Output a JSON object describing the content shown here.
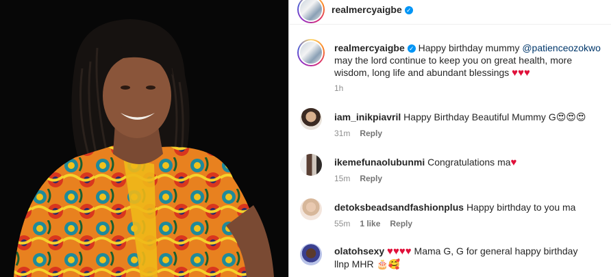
{
  "post": {
    "author": "realmercyaigbe",
    "caption_text": "Happy birthday mummy",
    "caption_mention": "@patienceozokwo",
    "caption_rest": "may the lord continue to keep you on great health, more wisdom, long life and abundant blessings",
    "caption_hearts": "♥♥♥",
    "time": "1h"
  },
  "comments": [
    {
      "username": "iam_inikpiavril",
      "text": "Happy Birthday Beautiful Mummy G",
      "emoji": "😍😍😍",
      "time": "31m",
      "likes": "",
      "reply": "Reply"
    },
    {
      "username": "ikemefunaolubunmi",
      "text": "Congratulations ma",
      "emoji": "♥",
      "time": "15m",
      "likes": "",
      "reply": "Reply"
    },
    {
      "username": "detoksbeadsandfashionplus",
      "text": "Happy birthday to you ma",
      "emoji": "",
      "time": "55m",
      "likes": "1 like",
      "reply": "Reply"
    },
    {
      "username": "olatohsexy",
      "text": "Mama G, G for general happy birthday",
      "hearts": "♥♥♥♥",
      "line2": "llnp MHR",
      "emoji": "🎂🥰"
    }
  ],
  "colors": {
    "accent": "#0095f6",
    "heart": "#e0103a",
    "mention": "#00376b",
    "meta": "#8e8e8e"
  }
}
